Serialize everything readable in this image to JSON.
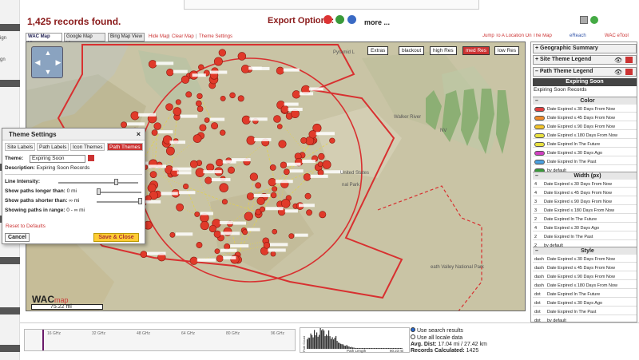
{
  "left_rail": {
    "labels": [
      "ign",
      "gn"
    ]
  },
  "header": {
    "records_found": "1,425 records found.",
    "export_label": "Export Options:",
    "more": "more ..."
  },
  "map_tabs": [
    "WAC Map View",
    "Google Map View",
    "Bing Map View"
  ],
  "map_links": [
    "Hide Map",
    "Clear Map",
    "Theme Settings"
  ],
  "separator": "|",
  "top_links": [
    "Jump To A Location On The Map",
    "eReach",
    "WAC eTool"
  ],
  "res_buttons": [
    "Extras",
    "blackout",
    "high Res",
    "med Res",
    "low Res"
  ],
  "map_labels": {
    "walker": "Walker River",
    "nv": "NV",
    "ulated": "United States",
    "national_park": "nal Park",
    "death_valley": "eath Valley National Park",
    "pyramid": "Pyramid L"
  },
  "logo": {
    "wac": "WAC",
    "map": "map"
  },
  "scale": "75.22 mi",
  "theme_settings": {
    "title": "Theme Settings",
    "close": "×",
    "tabs": [
      "Site Labels",
      "Path Labels",
      "Icon Themes",
      "Path Themes"
    ],
    "theme_label": "Theme:",
    "theme_value": "Expiring Soon",
    "description_label": "Description:",
    "description_value": "Expiring Soon Records",
    "line_intensity": "Line Intensity:",
    "show_longer": "Show paths longer than:",
    "longer_value": "0 mi",
    "show_shorter": "Show paths shorter than:",
    "shorter_value": "∞ mi",
    "range_label": "Showing paths in range:",
    "range_value": "0 - ∞ mi",
    "reset": "Reset to Defaults",
    "cancel": "Cancel",
    "save": "Save & Close"
  },
  "right_panel": {
    "geo": "Geographic Summary",
    "site_theme": "Site Theme Legend",
    "path_theme": "Path Theme Legend",
    "expiring": "Expiring Soon",
    "expiring_sub": "Expiring Soon Records",
    "color_head": "Color",
    "width_head": "Width (px)",
    "style_head": "Style",
    "color_rows": [
      {
        "label": "Date Expired  ≤ 30 Days From Now",
        "color": "#e04040"
      },
      {
        "label": "Date Expired  ≤ 45 Days From Now",
        "color": "#f08a2a"
      },
      {
        "label": "Date Expired  ≤ 90 Days From Now",
        "color": "#f2c42a"
      },
      {
        "label": "Date Expired  ≤ 180 Days From Now",
        "color": "#e8e040"
      },
      {
        "label": "Date Expired       In The Future",
        "color": "#e8e040"
      },
      {
        "label": "Date Expired  ≤ 30 Days Ago",
        "color": "#d040c0"
      },
      {
        "label": "Date Expired       In The Past",
        "color": "#4aa0e0"
      },
      {
        "label": "by default",
        "color": "#3a9a3a"
      }
    ],
    "width_rows": [
      {
        "w": "4",
        "label": "Date Expired  ≤ 30 Days From Now"
      },
      {
        "w": "4",
        "label": "Date Expired  ≤ 45 Days From Now"
      },
      {
        "w": "3",
        "label": "Date Expired  ≤ 90 Days From Now"
      },
      {
        "w": "3",
        "label": "Date Expired  ≤ 180 Days From Now"
      },
      {
        "w": "2",
        "label": "Date Expired       In The Future"
      },
      {
        "w": "4",
        "label": "Date Expired  ≤ 30 Days Ago"
      },
      {
        "w": "2",
        "label": "Date Expired       In The Past"
      },
      {
        "w": "2",
        "label": "by default"
      }
    ],
    "style_rows": [
      {
        "w": "dash",
        "label": "Date Expired  ≤ 30 Days From Now"
      },
      {
        "w": "dash",
        "label": "Date Expired  ≤ 45 Days From Now"
      },
      {
        "w": "dash",
        "label": "Date Expired  ≤ 90 Days From Now"
      },
      {
        "w": "dash",
        "label": "Date Expired  ≤ 180 Days From Now"
      },
      {
        "w": "dot",
        "label": "Date Expired       In The Future"
      },
      {
        "w": "dot",
        "label": "Date Expired  ≤ 30 Days Ago"
      },
      {
        "w": "dot",
        "label": "Date Expired       In The Past"
      },
      {
        "w": "dot",
        "label": "by default"
      }
    ]
  },
  "freq_ticks": [
    "16 GHz",
    "32 GHz",
    "48 GHz",
    "64 GHz",
    "80 GHz",
    "96 GHz"
  ],
  "hist": {
    "ylabel": "Path Count",
    "xlabel": "Path Length",
    "max": "80.23 mi"
  },
  "stats": {
    "use_search": "Use search results",
    "use_all": "Use all locale data",
    "avg_dist": "Avg. Dist:",
    "avg_val": "17.04 mi / 27.42 km",
    "records": "Records Calculated:",
    "records_val": "1425"
  },
  "colors": {
    "accent": "#cc3333",
    "site": "#e03a2a"
  }
}
